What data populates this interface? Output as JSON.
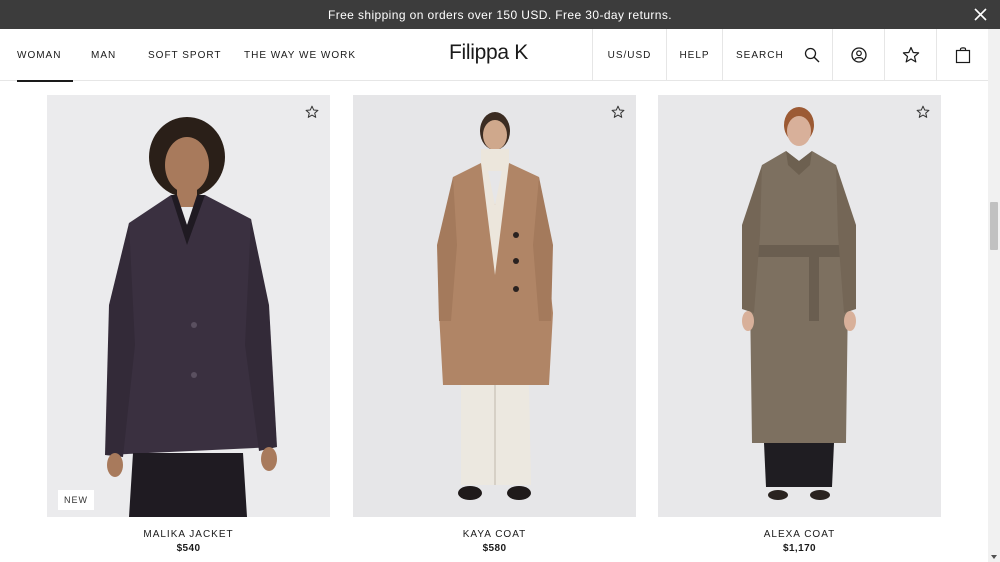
{
  "announcement": {
    "text": "Free shipping on orders over 150 USD. Free 30-day returns."
  },
  "nav": {
    "items": [
      {
        "label": "WOMAN",
        "active": true
      },
      {
        "label": "MAN",
        "active": false
      },
      {
        "label": "SOFT SPORT",
        "active": false
      },
      {
        "label": "THE WAY WE WORK",
        "active": false
      }
    ],
    "logo": "Filippa K",
    "currency": "US/USD",
    "help": "HELP",
    "search_label": "SEARCH"
  },
  "products": [
    {
      "name": "MALIKA JACKET",
      "price": "$540",
      "badge": "NEW"
    },
    {
      "name": "KAYA COAT",
      "price": "$580",
      "badge": ""
    },
    {
      "name": "ALEXA COAT",
      "price": "$1,170",
      "badge": ""
    }
  ],
  "icons": {
    "close": "close-icon",
    "search": "search-icon",
    "account": "account-icon",
    "wishlist": "star-icon",
    "bag": "bag-icon"
  },
  "colors": {
    "announcement_bg": "#3c3c3c",
    "photo_bg": "#ececec"
  }
}
